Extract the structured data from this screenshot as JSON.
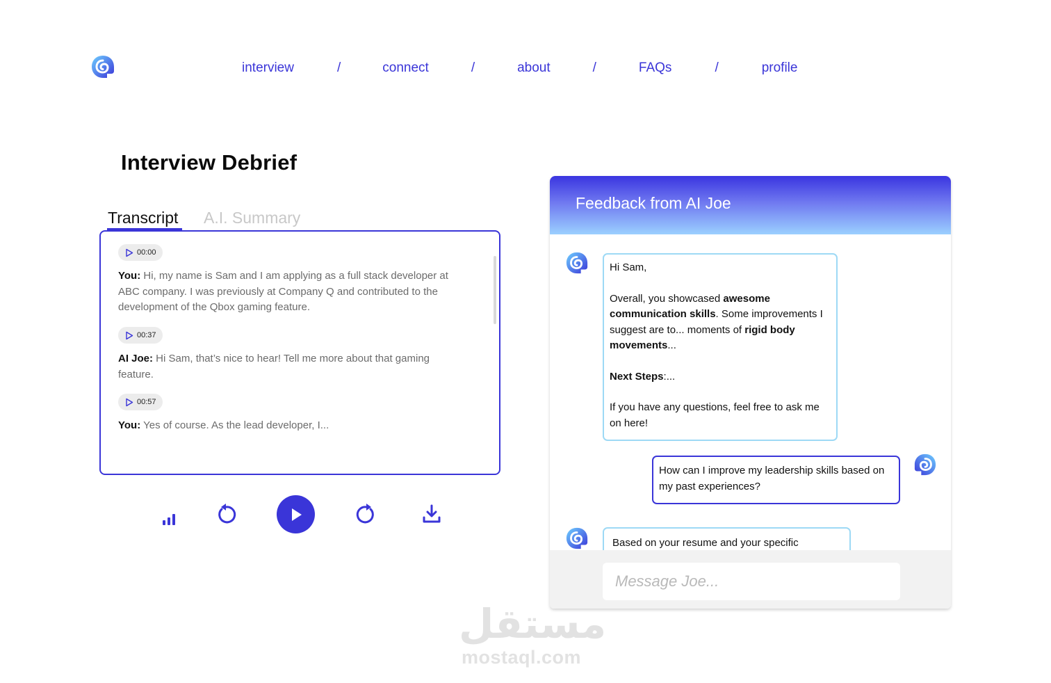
{
  "colors": {
    "accent": "#3a35d8",
    "ai_border": "#9dd9f5",
    "muted": "#c8c8c8"
  },
  "nav": {
    "items": [
      "interview",
      "connect",
      "about",
      "FAQs",
      "profile"
    ],
    "separator": "/"
  },
  "page_title": "Interview Debrief",
  "tabs": {
    "transcript": "Transcript",
    "summary": "A.I. Summary"
  },
  "transcript": [
    {
      "time": "00:00",
      "speaker": "You:",
      "text": " Hi, my name is Sam and I am applying as a full stack developer at ABC company. I was previously at Company Q and contributed to the development of the Qbox gaming feature."
    },
    {
      "time": "00:37",
      "speaker": "AI Joe:",
      "text": " Hi Sam, that’s nice to hear! Tell me more about that gaming feature."
    },
    {
      "time": "00:57",
      "speaker": "You:",
      "text": " Yes of course. As the lead developer, I..."
    }
  ],
  "controls": [
    "stats-icon",
    "rewind-icon",
    "play-icon",
    "forward-icon",
    "download-icon"
  ],
  "feedback": {
    "title": "Feedback from AI Joe",
    "greeting": "Hi Sam,",
    "p1_a": "Overall, you showcased ",
    "p1_b": "awesome communication skills",
    "p1_c": ". Some improvements I suggest are to... moments of ",
    "p1_d": "rigid body movements",
    "p1_e": "...",
    "next_label": "Next Steps",
    "next_rest": ":...",
    "closing": "If you have any questions, feel free to ask me on here!",
    "user_question": "How can I improve my leadership skills based on my past experiences?",
    "partial_reply": "Based on your resume and your specific",
    "input_placeholder": "Message Joe..."
  },
  "watermark": {
    "arabic": "مستقل",
    "latin": "mostaql.com"
  }
}
